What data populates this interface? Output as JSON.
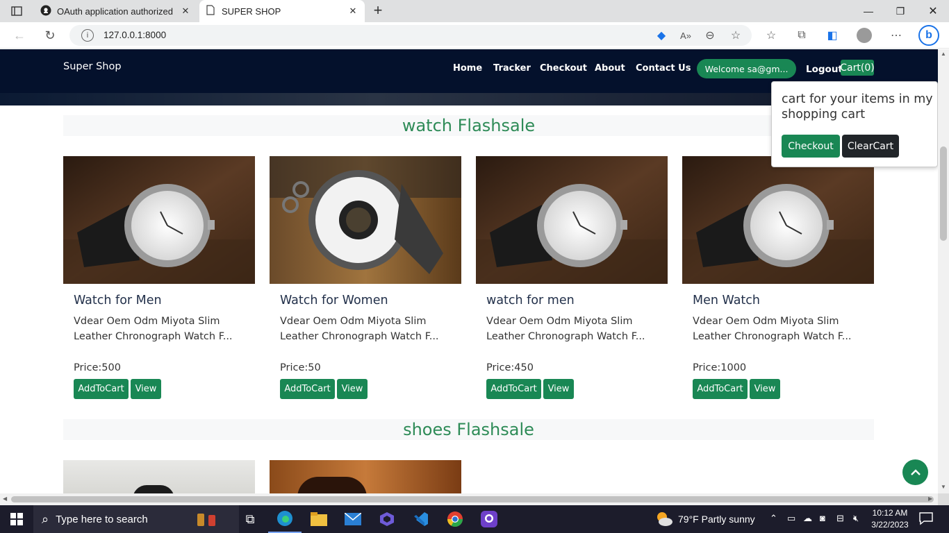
{
  "browser": {
    "tabs": [
      {
        "title": "OAuth application authorized",
        "icon": "github-icon"
      },
      {
        "title": "SUPER SHOP",
        "icon": "page-icon"
      }
    ],
    "url": "127.0.0.1:8000"
  },
  "nav": {
    "brand": "Super Shop",
    "links": [
      "Home",
      "Tracker",
      "Checkout",
      "About",
      "Contact Us"
    ],
    "welcome": "Welcome sa@gm...",
    "logout": "Logout",
    "cart": "Cart(0)"
  },
  "popover": {
    "text": "cart for your items in my shopping cart",
    "checkout": "Checkout",
    "clear": "ClearCart"
  },
  "sections": [
    {
      "title": "watch Flashsale",
      "products": [
        {
          "name": "Watch for Men",
          "desc": "Vdear Oem Odm Miyota Slim Leather Chronograph Watch F...",
          "price": "Price:500",
          "add": "AddToCart",
          "view": "View"
        },
        {
          "name": "Watch for Women",
          "desc": "Vdear Oem Odm Miyota Slim Leather Chronograph Watch F...",
          "price": "Price:50",
          "add": "AddToCart",
          "view": "View"
        },
        {
          "name": "watch for men",
          "desc": "Vdear Oem Odm Miyota Slim Leather Chronograph Watch F...",
          "price": "Price:450",
          "add": "AddToCart",
          "view": "View"
        },
        {
          "name": "Men Watch",
          "desc": "Vdear Oem Odm Miyota Slim Leather Chronograph Watch F...",
          "price": "Price:1000",
          "add": "AddToCart",
          "view": "View"
        }
      ]
    },
    {
      "title": "shoes Flashsale",
      "products": []
    }
  ],
  "taskbar": {
    "search": "Type here to search",
    "weather": "79°F  Partly sunny",
    "time": "10:12 AM",
    "date": "3/22/2023"
  },
  "colors": {
    "brand_green": "#198754",
    "navbar": "#04112c",
    "heading_green": "#2e8b57"
  }
}
